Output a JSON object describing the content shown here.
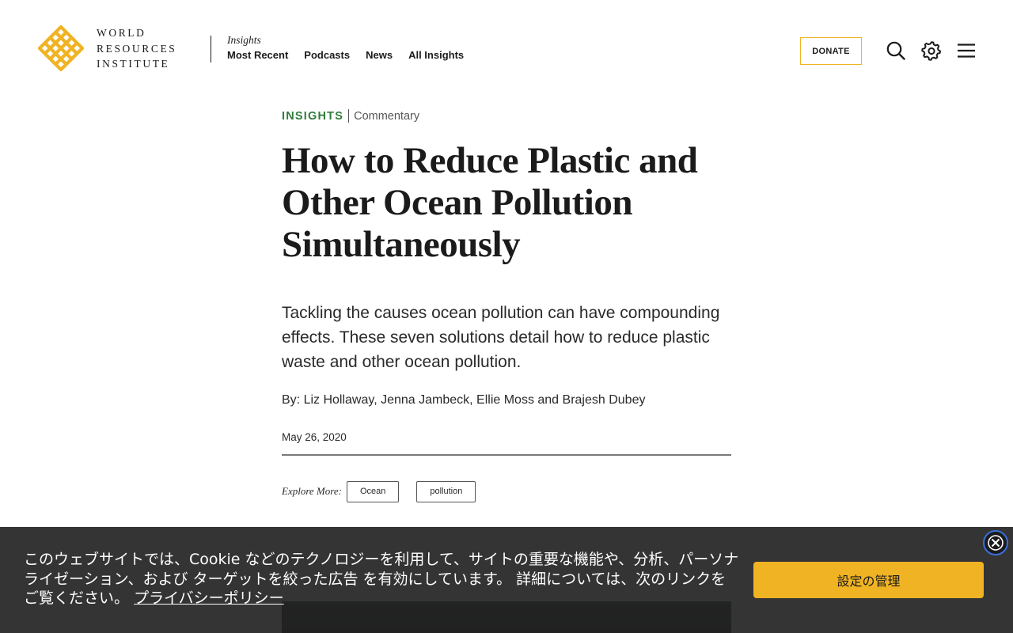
{
  "brand": {
    "name_lines": [
      "WORLD",
      "RESOURCES",
      "INSTITUTE"
    ],
    "accent_color": "#f0b323",
    "icon": "wri-logo-mark"
  },
  "nav": {
    "section": "Insights",
    "links": [
      "Most Recent",
      "Podcasts",
      "News",
      "All Insights"
    ]
  },
  "header_actions": {
    "donate_label": "DONATE",
    "icons": [
      "search-icon",
      "gear-icon",
      "hamburger-menu-icon"
    ]
  },
  "article": {
    "kicker": "INSIGHTS",
    "kicker_color": "#2f7d3b",
    "type": "Commentary",
    "title_lines": [
      "How to Reduce Plastic and",
      "Other Ocean Pollution",
      "Simultaneously"
    ],
    "dek": "Tackling the causes ocean pollution can have compounding effects. These seven solutions detail how to reduce plastic waste and other ocean pollution.",
    "byline": "By: Liz Hollaway, Jenna Jambeck, Ellie Moss and Brajesh Dubey",
    "date": "May 26, 2020",
    "explore_label": "Explore More:",
    "tags": [
      "Ocean",
      "pollution"
    ]
  },
  "cookie_banner": {
    "text": "このウェブサイトでは、Cookie などのテクノロジーを利用して、サイトの重要な機能や、分析、パーソナライゼーション、および ターゲットを絞った広告 を有効にしています。 詳細については、次のリンクをご覧ください。",
    "privacy_link": "プライバシーポリシー",
    "settings_button": "設定の管理",
    "close_icon": "close-icon"
  }
}
